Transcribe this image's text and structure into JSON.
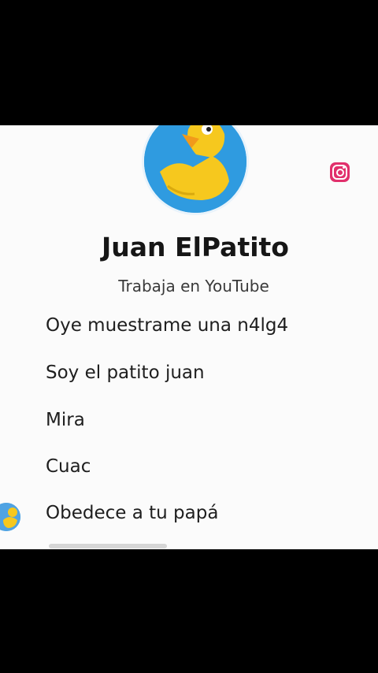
{
  "profile": {
    "name": "Juan ElPatito",
    "subtitle": "Trabaja en YouTube",
    "avatar_icon": "duck-avatar-icon"
  },
  "overlay": {
    "icon": "instagram-icon",
    "icon_color": "#e1306c"
  },
  "messages": [
    {
      "text": "Oye muestrame una n4lg4"
    },
    {
      "text": "Soy el patito juan"
    },
    {
      "text": "Mira"
    },
    {
      "text": "Cuac"
    },
    {
      "text": "Obedece a tu papá"
    }
  ],
  "colors": {
    "letterbox": "#000000",
    "panel": "#fbfbfb",
    "text": "#1e1e1e",
    "avatar_bg": "#2f9be0",
    "duck_yellow": "#f6c81e"
  }
}
